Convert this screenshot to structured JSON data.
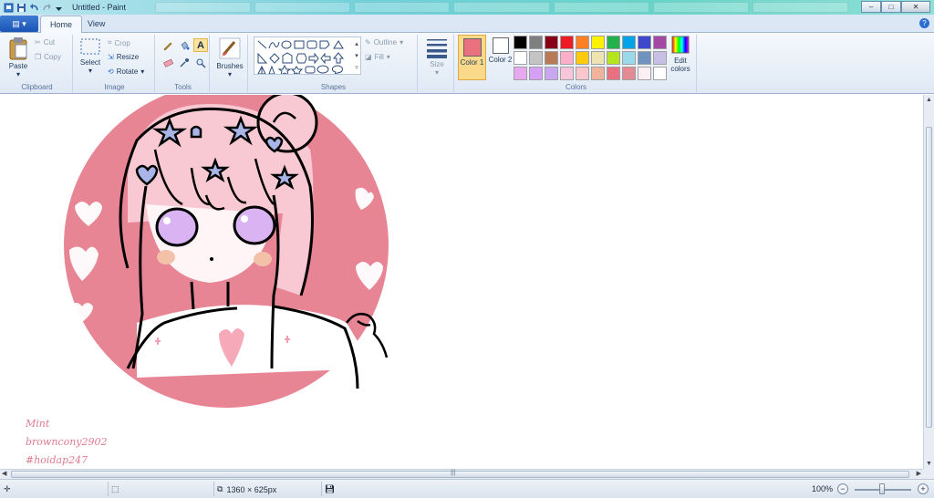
{
  "window": {
    "title": "Untitled - Paint",
    "minimize": "–",
    "maximize": "□",
    "close": "✕"
  },
  "tabs": {
    "file": "▤ ▾",
    "home": "Home",
    "view": "View",
    "help": "?"
  },
  "ribbon": {
    "clipboard": {
      "label": "Clipboard",
      "paste": "Paste",
      "cut": "Cut",
      "copy": "Copy"
    },
    "image": {
      "label": "Image",
      "select": "Select",
      "crop": "Crop",
      "resize": "Resize",
      "rotate": "Rotate"
    },
    "tools": {
      "label": "Tools"
    },
    "brushes": {
      "label": "Brushes"
    },
    "shapes": {
      "label": "Shapes",
      "outline": "Outline",
      "fill": "Fill"
    },
    "size": {
      "label": "Size"
    },
    "colors": {
      "label": "Colors",
      "color1": "Color 1",
      "color2": "Color 2",
      "edit_colors": "Edit colors",
      "color1_value": "#e8707f",
      "color2_value": "#ffffff",
      "palette": [
        "#000000",
        "#7f7f7f",
        "#880015",
        "#ed1c24",
        "#ff7f27",
        "#fff200",
        "#22b14c",
        "#00a2e8",
        "#3f48cc",
        "#a349a4",
        "#ffffff",
        "#c3c3c3",
        "#b97a57",
        "#ffaec9",
        "#ffc90e",
        "#efe4b0",
        "#b5e61d",
        "#99d9ea",
        "#7092be",
        "#c8bfe7",
        "#e7a8f0",
        "#d6a0f8",
        "#c9a7f0",
        "#f7c5d8",
        "#f8c6cc",
        "#f2b39b",
        "#e8707f",
        "#e38a93",
        "#fbeff3",
        "#ffffff"
      ]
    }
  },
  "canvas": {
    "watermark_lines": [
      "Mint",
      "browncony2902",
      "#hoidap247"
    ]
  },
  "statusbar": {
    "dimensions": "1360 × 625px",
    "zoom": "100%",
    "zoom_value_percent": 100
  }
}
